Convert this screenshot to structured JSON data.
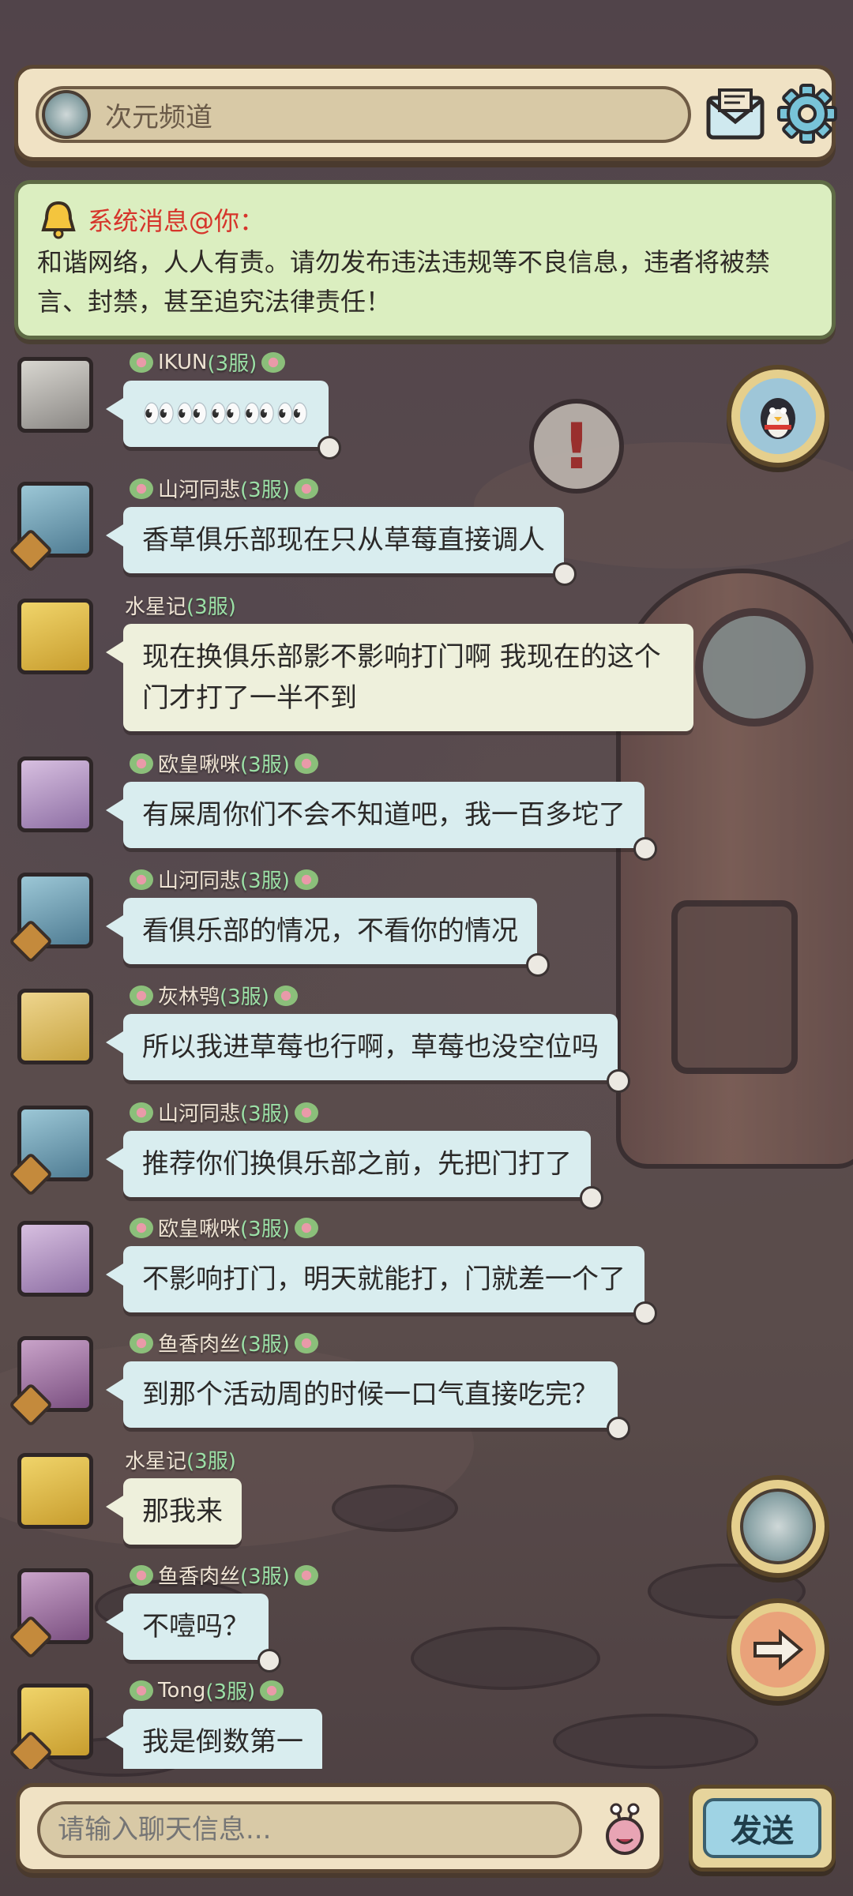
{
  "header": {
    "channel_name": "次元频道",
    "icons": {
      "channel": "planet-icon",
      "mail": "mail-icon",
      "settings": "gear-icon"
    }
  },
  "notice": {
    "title": "系统消息@你：",
    "body": "和谐网络，人人有责。请勿发布违法违规等不良信息，违者将被禁言、封禁，甚至追究法律责任！"
  },
  "messages": [
    {
      "name": "IKUN",
      "server": "(3服)",
      "text": "👀👀👀👀👀"
    },
    {
      "name": "山河同悲",
      "server": "(3服)",
      "text": "香草俱乐部现在只从草莓直接调人"
    },
    {
      "name": "水星记",
      "server": "(3服)",
      "text": "现在换俱乐部影不影响打门啊  我现在的这个门才打了一半不到"
    },
    {
      "name": "欧皇啾咪",
      "server": "(3服)",
      "text": "有屎周你们不会不知道吧，我一百多坨了"
    },
    {
      "name": "山河同悲",
      "server": "(3服)",
      "text": "看俱乐部的情况，不看你的情况"
    },
    {
      "name": "灰林鸮",
      "server": "(3服)",
      "text": "所以我进草莓也行啊，草莓也没空位吗"
    },
    {
      "name": "山河同悲",
      "server": "(3服)",
      "text": "推荐你们换俱乐部之前，先把门打了"
    },
    {
      "name": "欧皇啾咪",
      "server": "(3服)",
      "text": "不影响打门，明天就能打，门就差一个了"
    },
    {
      "name": "鱼香肉丝",
      "server": "(3服)",
      "text": "到那个活动周的时候一口气直接吃完？"
    },
    {
      "name": "水星记",
      "server": "(3服)",
      "text": "那我来"
    },
    {
      "name": "鱼香肉丝",
      "server": "(3服)",
      "text": "不噎吗？"
    },
    {
      "name": "Tong",
      "server": "(3服)",
      "text": "我是倒数第一"
    }
  ],
  "side_buttons": {
    "top": "penguin-icon",
    "mid": "planet-icon",
    "bottom": "arrow-right-icon"
  },
  "input": {
    "placeholder": "请输入聊天信息...",
    "send_label": "发送"
  },
  "colors": {
    "notice_title": "#d6352b",
    "server_tag": "#9be0a6",
    "bubble": "#d9edef"
  }
}
